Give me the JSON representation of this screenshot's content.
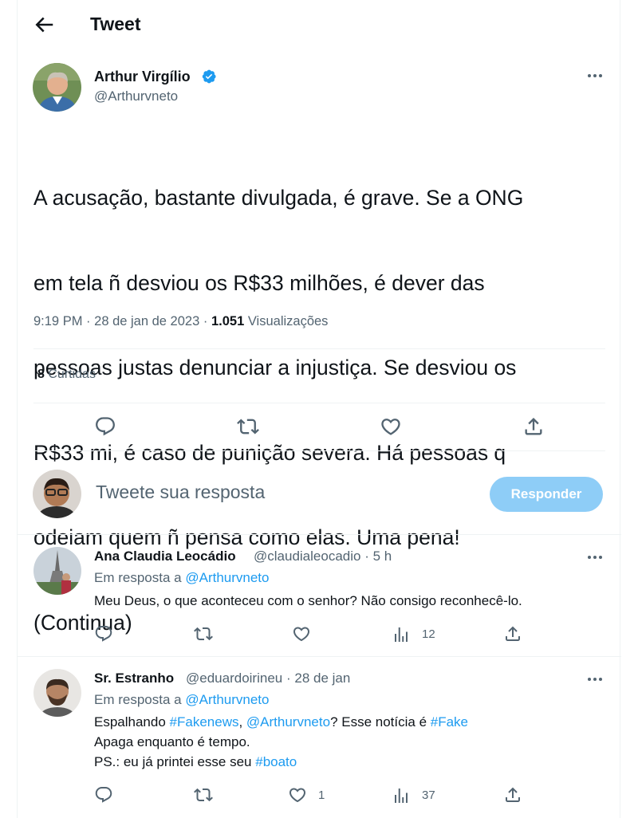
{
  "header": {
    "title": "Tweet"
  },
  "main_tweet": {
    "author_name": "Arthur Virgílio",
    "author_handle": "@Arthurvneto",
    "text_lines": [
      "A acusação, bastante divulgada, é grave. Se a ONG",
      "em tela ñ desviou os R$33 milhões, é dever das",
      "pessoas justas denunciar a injustiça. Se desviou os",
      "R$33 mi, é caso de punição severa. Há pessoas q",
      "odeiam quem ñ pensa como elas. Uma pena!",
      "(Continua)"
    ],
    "time": "9:19 PM",
    "date": "28 de jan de 2023",
    "views_count": "1.051",
    "views_label": "Visualizações",
    "likes_count": "8",
    "likes_label": "Curtidas"
  },
  "composer": {
    "placeholder": "Tweete sua resposta",
    "button_label": "Responder",
    "button_color": "#8ecdf7"
  },
  "replies": [
    {
      "name": "Ana Claudia Leocádio",
      "handle": "@claudialeocadio",
      "time": "5 h",
      "in_reply_prefix": "Em resposta a",
      "in_reply_handle": "@Arthurvneto",
      "text": "Meu Deus, o que aconteceu com o senhor? Não consigo reconhecê-lo.",
      "likes": "",
      "views": "12"
    },
    {
      "name": "Sr. Estranho",
      "handle": "@eduardoirineu",
      "time": "28 de jan",
      "in_reply_prefix": "Em resposta a",
      "in_reply_handle": "@Arthurvneto",
      "line1_a": "Espalhando ",
      "line1_tag1": "#Fakenews",
      "line1_b": ", ",
      "line1_mention": "@Arthurvneto",
      "line1_c": "? Esse notícia é ",
      "line1_tag2": "#Fake",
      "line2": "Apaga enquanto é tempo.",
      "line3_a": "PS.: eu já printei esse seu ",
      "line3_tag": "#boato",
      "likes": "1",
      "views": "37"
    }
  ],
  "separator": "·",
  "colors": {
    "link": "#1d9bf0",
    "secondary_text": "#536471",
    "verified": "#1d9bf0"
  }
}
